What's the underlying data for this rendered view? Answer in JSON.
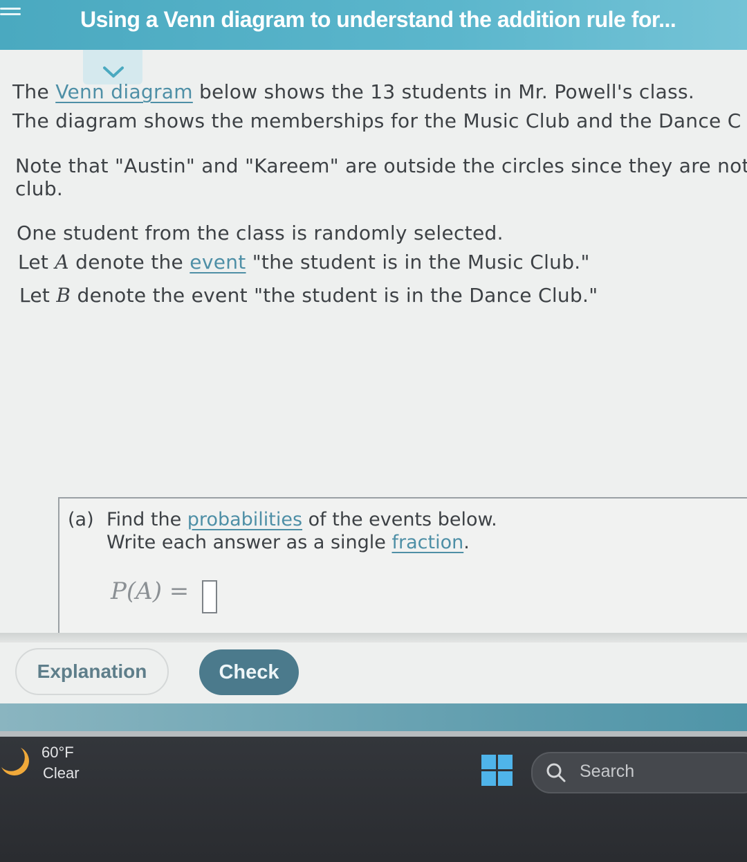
{
  "header": {
    "title": "Using a Venn diagram to understand the addition rule for..."
  },
  "intro": {
    "line1_pre": "The ",
    "line1_link": "Venn diagram",
    "line1_post": " below shows the 13 students in Mr. Powell's class.",
    "line2": "The diagram shows the memberships for the Music Club and the Dance C",
    "note_line1": "Note that \"Austin\" and \"Kareem\" are outside the circles since they are not",
    "note_line2": "club.",
    "select_line": "One student from the class is randomly selected.",
    "letA_pre": "Let ",
    "letA_var": "A",
    "letA_mid": " denote the ",
    "letA_link": "event",
    "letA_post": " \"the student is in the Music Club.\"",
    "letB_pre": "Let ",
    "letB_var": "B",
    "letB_post": " denote the event \"the student is in the Dance Club.\""
  },
  "question": {
    "part_label": "(a)",
    "line1_pre": "Find the ",
    "line1_link": "probabilities",
    "line1_post": " of the events below.",
    "line2_pre": "Write each answer as a single ",
    "line2_link": "fraction",
    "line2_post": ".",
    "formula": "P(A) =",
    "answer_value": ""
  },
  "buttons": {
    "explanation": "Explanation",
    "check": "Check"
  },
  "taskbar": {
    "temperature": "60°F",
    "condition": "Clear",
    "search_label": "Search",
    "icons": [
      "moon-icon",
      "windows-logo-icon",
      "search-icon"
    ]
  },
  "colors": {
    "header": "#4aa9c0",
    "link": "#4e8fa6",
    "check_button": "#4b7a8c",
    "taskbar": "#2f3236"
  }
}
